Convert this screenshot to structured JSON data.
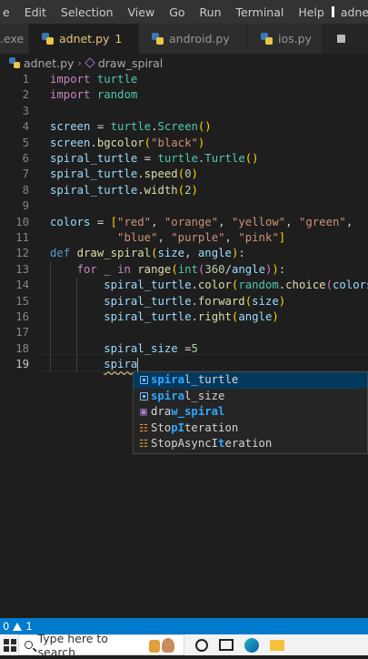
{
  "menubar": {
    "items": [
      "e",
      "Edit",
      "Selection",
      "View",
      "Go",
      "Run",
      "Terminal",
      "Help"
    ],
    "window_title": "adnet.py - Vi"
  },
  "tabs": [
    {
      "label": ".exe",
      "active": false,
      "dirty": false
    },
    {
      "label": "adnet.py",
      "badge": "1",
      "active": true,
      "dirty": true
    },
    {
      "label": "android.py",
      "active": false,
      "dirty": false
    },
    {
      "label": "ios.py",
      "active": false,
      "dirty": false
    }
  ],
  "breadcrumb": {
    "file": "adnet.py",
    "symbol": "draw_spiral"
  },
  "editor": {
    "line_numbers": [
      "1",
      "2",
      "3",
      "4",
      "5",
      "6",
      "7",
      "8",
      "9",
      "10",
      "11",
      "12",
      "13",
      "14",
      "15",
      "16",
      "17",
      "18",
      "19"
    ],
    "current_line": "19",
    "lines": [
      [
        [
          "kw",
          "import"
        ],
        [
          "pl",
          " "
        ],
        [
          "mod",
          "turtle"
        ]
      ],
      [
        [
          "kw",
          "import"
        ],
        [
          "pl",
          " "
        ],
        [
          "mod",
          "random"
        ]
      ],
      [],
      [
        [
          "var",
          "screen"
        ],
        [
          "pl",
          " = "
        ],
        [
          "mod",
          "turtle"
        ],
        [
          "pl",
          "."
        ],
        [
          "mod",
          "Screen"
        ],
        [
          "br1",
          "()"
        ]
      ],
      [
        [
          "var",
          "screen"
        ],
        [
          "pl",
          "."
        ],
        [
          "fn",
          "bgcolor"
        ],
        [
          "br1",
          "("
        ],
        [
          "str",
          "\"black\""
        ],
        [
          "br1",
          ")"
        ]
      ],
      [
        [
          "var",
          "spiral_turtle"
        ],
        [
          "pl",
          " = "
        ],
        [
          "mod",
          "turtle"
        ],
        [
          "pl",
          "."
        ],
        [
          "mod",
          "Turtle"
        ],
        [
          "br1",
          "()"
        ]
      ],
      [
        [
          "var",
          "spiral_turtle"
        ],
        [
          "pl",
          "."
        ],
        [
          "fn",
          "speed"
        ],
        [
          "br1",
          "("
        ],
        [
          "num",
          "0"
        ],
        [
          "br1",
          ")"
        ]
      ],
      [
        [
          "var",
          "spiral_turtle"
        ],
        [
          "pl",
          "."
        ],
        [
          "fn",
          "width"
        ],
        [
          "br1",
          "("
        ],
        [
          "num",
          "2"
        ],
        [
          "br1",
          ")"
        ]
      ],
      [],
      [
        [
          "var",
          "colors"
        ],
        [
          "pl",
          " = "
        ],
        [
          "br1",
          "["
        ],
        [
          "str",
          "\"red\""
        ],
        [
          "pl",
          ", "
        ],
        [
          "str",
          "\"orange\""
        ],
        [
          "pl",
          ", "
        ],
        [
          "str",
          "\"yellow\""
        ],
        [
          "pl",
          ", "
        ],
        [
          "str",
          "\"green\""
        ],
        [
          "pl",
          ","
        ]
      ],
      [
        [
          "pl",
          "          "
        ],
        [
          "str",
          "\"blue\""
        ],
        [
          "pl",
          ", "
        ],
        [
          "str",
          "\"purple\""
        ],
        [
          "pl",
          ", "
        ],
        [
          "str",
          "\"pink\""
        ],
        [
          "br1",
          "]"
        ]
      ],
      [
        [
          "dkw",
          "def"
        ],
        [
          "pl",
          " "
        ],
        [
          "fn",
          "draw_spiral"
        ],
        [
          "br1",
          "("
        ],
        [
          "var",
          "size"
        ],
        [
          "pl",
          ", "
        ],
        [
          "var",
          "angle"
        ],
        [
          "br1",
          ")"
        ],
        [
          "pl",
          ":"
        ]
      ],
      [
        [
          "pl",
          "    "
        ],
        [
          "kw",
          "for"
        ],
        [
          "pl",
          " "
        ],
        [
          "var",
          "_"
        ],
        [
          "pl",
          " "
        ],
        [
          "kw",
          "in"
        ],
        [
          "pl",
          " "
        ],
        [
          "fn",
          "range"
        ],
        [
          "br1",
          "("
        ],
        [
          "mod",
          "int"
        ],
        [
          "br2",
          "("
        ],
        [
          "num",
          "360"
        ],
        [
          "pl",
          "/"
        ],
        [
          "var",
          "angle"
        ],
        [
          "br2",
          ")"
        ],
        [
          "br1",
          ")"
        ],
        [
          "pl",
          ":"
        ]
      ],
      [
        [
          "pl",
          "        "
        ],
        [
          "var",
          "spiral_turtle"
        ],
        [
          "pl",
          "."
        ],
        [
          "fn",
          "color"
        ],
        [
          "br1",
          "("
        ],
        [
          "mod",
          "random"
        ],
        [
          "pl",
          "."
        ],
        [
          "fn",
          "choice"
        ],
        [
          "br2",
          "("
        ],
        [
          "var",
          "colors"
        ],
        [
          "br2",
          ")"
        ],
        [
          "br1",
          ")"
        ]
      ],
      [
        [
          "pl",
          "        "
        ],
        [
          "var",
          "spiral_turtle"
        ],
        [
          "pl",
          "."
        ],
        [
          "fn",
          "forward"
        ],
        [
          "br1",
          "("
        ],
        [
          "var",
          "size"
        ],
        [
          "br1",
          ")"
        ]
      ],
      [
        [
          "pl",
          "        "
        ],
        [
          "var",
          "spiral_turtle"
        ],
        [
          "pl",
          "."
        ],
        [
          "fn",
          "right"
        ],
        [
          "br1",
          "("
        ],
        [
          "var",
          "angle"
        ],
        [
          "br1",
          ")"
        ]
      ],
      [],
      [
        [
          "pl",
          "        "
        ],
        [
          "var",
          "spiral_size"
        ],
        [
          "pl",
          " ="
        ],
        [
          "num",
          "5"
        ]
      ],
      [
        [
          "pl",
          "        "
        ],
        [
          "var",
          "spira"
        ]
      ]
    ]
  },
  "suggestions": [
    {
      "kind": "variable",
      "icon": "variable-icon",
      "match": "spira",
      "rest": "l_turtle",
      "selected": true
    },
    {
      "kind": "variable",
      "icon": "variable-icon",
      "match": "spira",
      "rest": "l_size",
      "selected": false
    },
    {
      "kind": "function",
      "icon": "function-icon",
      "pre": "dra",
      "match": "w_spiral",
      "rest": "",
      "selected": false
    },
    {
      "kind": "class",
      "icon": "class-icon",
      "pre": "Sto",
      "match": "pI",
      "rest": "teration",
      "selected": false
    },
    {
      "kind": "class",
      "icon": "class-icon",
      "pre": "StopAsyncI",
      "match": "t",
      "rest": "eration",
      "selected": false
    }
  ],
  "statusbar": {
    "errors": "0",
    "warnings": "1"
  },
  "taskbar": {
    "search_placeholder": "Type here to search"
  },
  "colors": {
    "accent": "#007acc",
    "selection": "#04395e",
    "tab_active_text": "#e7c27d"
  }
}
